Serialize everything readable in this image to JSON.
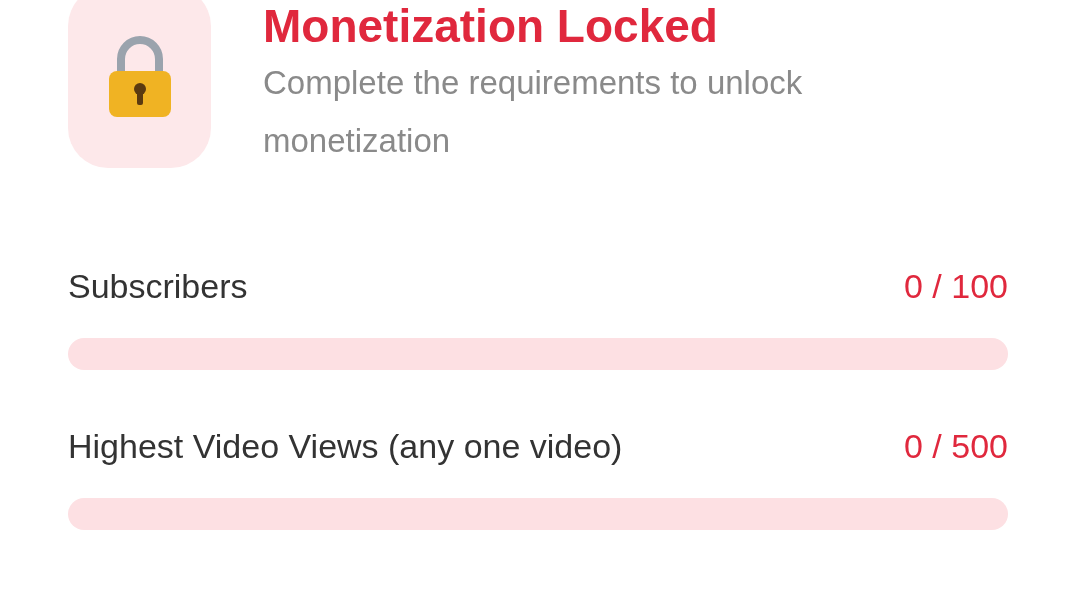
{
  "header": {
    "title": "Monetization Locked",
    "subtitle": "Complete the requirements to unlock monetization"
  },
  "requirements": [
    {
      "label": "Subscribers",
      "reading": "0 / 100",
      "level": 0
    },
    {
      "label": "Highest Video Views (any one video)",
      "reading": "0 / 500",
      "level": 0
    }
  ]
}
